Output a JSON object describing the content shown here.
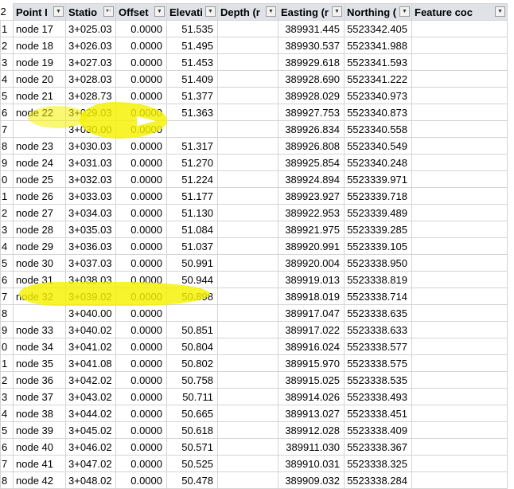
{
  "headers": [
    {
      "key": "rownum_hdr",
      "label": "2",
      "filter": null
    },
    {
      "key": "point",
      "label": "Point I",
      "filter": "dropdown"
    },
    {
      "key": "station",
      "label": "Statio",
      "filter": "sort-asc"
    },
    {
      "key": "offset",
      "label": "Offset",
      "filter": "dropdown"
    },
    {
      "key": "elevation",
      "label": "Elevati",
      "filter": "dropdown"
    },
    {
      "key": "depth",
      "label": "Depth (r",
      "filter": "dropdown"
    },
    {
      "key": "easting",
      "label": "Easting (r",
      "filter": "dropdown"
    },
    {
      "key": "northing",
      "label": "Northing (n",
      "filter": "dropdown"
    },
    {
      "key": "feature",
      "label": "Feature coc",
      "filter": "dropdown"
    }
  ],
  "rows": [
    {
      "rn": "1",
      "point": "node 17",
      "station": "3+025.03",
      "offset": "0.0000",
      "elevation": "51.535",
      "depth": "",
      "easting": "389931.445",
      "northing": "5523342.405",
      "feature": "",
      "highlight": false
    },
    {
      "rn": "2",
      "point": "node 18",
      "station": "3+026.03",
      "offset": "0.0000",
      "elevation": "51.495",
      "depth": "",
      "easting": "389930.537",
      "northing": "5523341.988",
      "feature": "",
      "highlight": false
    },
    {
      "rn": "3",
      "point": "node 19",
      "station": "3+027.03",
      "offset": "0.0000",
      "elevation": "51.453",
      "depth": "",
      "easting": "389929.618",
      "northing": "5523341.593",
      "feature": "",
      "highlight": false
    },
    {
      "rn": "4",
      "point": "node 20",
      "station": "3+028.03",
      "offset": "0.0000",
      "elevation": "51.409",
      "depth": "",
      "easting": "389928.690",
      "northing": "5523341.222",
      "feature": "",
      "highlight": false
    },
    {
      "rn": "5",
      "point": "node 21",
      "station": "3+028.73",
      "offset": "0.0000",
      "elevation": "51.377",
      "depth": "",
      "easting": "389928.029",
      "northing": "5523340.973",
      "feature": "",
      "highlight": false
    },
    {
      "rn": "6",
      "point": "node 22",
      "station": "3+029.03",
      "offset": "0.0000",
      "elevation": "51.363",
      "depth": "",
      "easting": "389927.753",
      "northing": "5523340.873",
      "feature": "",
      "highlight": false
    },
    {
      "rn": "7",
      "point": "",
      "station": "3+030.00",
      "offset": "0.0000",
      "elevation": "",
      "depth": "",
      "easting": "389926.834",
      "northing": "5523340.558",
      "feature": "",
      "highlight": true
    },
    {
      "rn": "8",
      "point": "node 23",
      "station": "3+030.03",
      "offset": "0.0000",
      "elevation": "51.317",
      "depth": "",
      "easting": "389926.808",
      "northing": "5523340.549",
      "feature": "",
      "highlight": false
    },
    {
      "rn": "9",
      "point": "node 24",
      "station": "3+031.03",
      "offset": "0.0000",
      "elevation": "51.270",
      "depth": "",
      "easting": "389925.854",
      "northing": "5523340.248",
      "feature": "",
      "highlight": false
    },
    {
      "rn": "0",
      "point": "node 25",
      "station": "3+032.03",
      "offset": "0.0000",
      "elevation": "51.224",
      "depth": "",
      "easting": "389924.894",
      "northing": "5523339.971",
      "feature": "",
      "highlight": false
    },
    {
      "rn": "1",
      "point": "node 26",
      "station": "3+033.03",
      "offset": "0.0000",
      "elevation": "51.177",
      "depth": "",
      "easting": "389923.927",
      "northing": "5523339.718",
      "feature": "",
      "highlight": false
    },
    {
      "rn": "2",
      "point": "node 27",
      "station": "3+034.03",
      "offset": "0.0000",
      "elevation": "51.130",
      "depth": "",
      "easting": "389922.953",
      "northing": "5523339.489",
      "feature": "",
      "highlight": false
    },
    {
      "rn": "3",
      "point": "node 28",
      "station": "3+035.03",
      "offset": "0.0000",
      "elevation": "51.084",
      "depth": "",
      "easting": "389921.975",
      "northing": "5523339.285",
      "feature": "",
      "highlight": false
    },
    {
      "rn": "4",
      "point": "node 29",
      "station": "3+036.03",
      "offset": "0.0000",
      "elevation": "51.037",
      "depth": "",
      "easting": "389920.991",
      "northing": "5523339.105",
      "feature": "",
      "highlight": false
    },
    {
      "rn": "5",
      "point": "node 30",
      "station": "3+037.03",
      "offset": "0.0000",
      "elevation": "50.991",
      "depth": "",
      "easting": "389920.004",
      "northing": "5523338.950",
      "feature": "",
      "highlight": false
    },
    {
      "rn": "6",
      "point": "node 31",
      "station": "3+038.03",
      "offset": "0.0000",
      "elevation": "50.944",
      "depth": "",
      "easting": "389919.013",
      "northing": "5523338.819",
      "feature": "",
      "highlight": false
    },
    {
      "rn": "7",
      "point": "node 32",
      "station": "3+039.02",
      "offset": "0.0000",
      "elevation": "50.898",
      "depth": "",
      "easting": "389918.019",
      "northing": "5523338.714",
      "feature": "",
      "highlight": false
    },
    {
      "rn": "8",
      "point": "",
      "station": "3+040.00",
      "offset": "0.0000",
      "elevation": "",
      "depth": "",
      "easting": "389917.047",
      "northing": "5523338.635",
      "feature": "",
      "highlight": true
    },
    {
      "rn": "9",
      "point": "node 33",
      "station": "3+040.02",
      "offset": "0.0000",
      "elevation": "50.851",
      "depth": "",
      "easting": "389917.022",
      "northing": "5523338.633",
      "feature": "",
      "highlight": false
    },
    {
      "rn": "0",
      "point": "node 34",
      "station": "3+041.02",
      "offset": "0.0000",
      "elevation": "50.804",
      "depth": "",
      "easting": "389916.024",
      "northing": "5523338.577",
      "feature": "",
      "highlight": false
    },
    {
      "rn": "1",
      "point": "node 35",
      "station": "3+041.08",
      "offset": "0.0000",
      "elevation": "50.802",
      "depth": "",
      "easting": "389915.970",
      "northing": "5523338.575",
      "feature": "",
      "highlight": false
    },
    {
      "rn": "2",
      "point": "node 36",
      "station": "3+042.02",
      "offset": "0.0000",
      "elevation": "50.758",
      "depth": "",
      "easting": "389915.025",
      "northing": "5523338.535",
      "feature": "",
      "highlight": false
    },
    {
      "rn": "3",
      "point": "node 37",
      "station": "3+043.02",
      "offset": "0.0000",
      "elevation": "50.711",
      "depth": "",
      "easting": "389914.026",
      "northing": "5523338.493",
      "feature": "",
      "highlight": false
    },
    {
      "rn": "4",
      "point": "node 38",
      "station": "3+044.02",
      "offset": "0.0000",
      "elevation": "50.665",
      "depth": "",
      "easting": "389913.027",
      "northing": "5523338.451",
      "feature": "",
      "highlight": false
    },
    {
      "rn": "5",
      "point": "node 39",
      "station": "3+045.02",
      "offset": "0.0000",
      "elevation": "50.618",
      "depth": "",
      "easting": "389912.028",
      "northing": "5523338.409",
      "feature": "",
      "highlight": false
    },
    {
      "rn": "6",
      "point": "node 40",
      "station": "3+046.02",
      "offset": "0.0000",
      "elevation": "50.571",
      "depth": "",
      "easting": "389911.030",
      "northing": "5523338.367",
      "feature": "",
      "highlight": false
    },
    {
      "rn": "7",
      "point": "node 41",
      "station": "3+047.02",
      "offset": "0.0000",
      "elevation": "50.525",
      "depth": "",
      "easting": "389910.031",
      "northing": "5523338.325",
      "feature": "",
      "highlight": false
    },
    {
      "rn": "8",
      "point": "node 42",
      "station": "3+048.02",
      "offset": "0.0000",
      "elevation": "50.478",
      "depth": "",
      "easting": "389909.032",
      "northing": "5523338.284",
      "feature": "",
      "highlight": false
    }
  ],
  "colors": {
    "highlight": "#f5f200",
    "header_bg": "#dfe3e8",
    "gridline": "#d4d4d4"
  },
  "icons": {
    "filter": "filter-dropdown-icon",
    "sort": "sort-ascending-icon"
  }
}
